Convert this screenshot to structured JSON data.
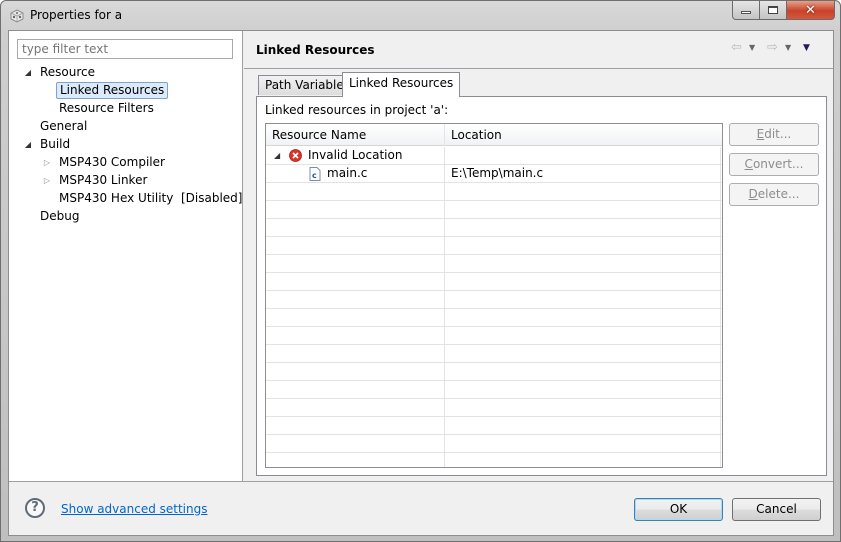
{
  "window": {
    "title": "Properties for a",
    "icon": "gear-cube-icon",
    "controls": [
      "minimize",
      "maximize",
      "close"
    ]
  },
  "sidebar": {
    "filter_placeholder": "type filter text",
    "filter_value": "",
    "tree": [
      {
        "label": "Resource",
        "level": 0,
        "expander": "expanded"
      },
      {
        "label": "Linked Resources",
        "level": 1,
        "expander": "none",
        "selected": true
      },
      {
        "label": "Resource Filters",
        "level": 1,
        "expander": "none"
      },
      {
        "label": "General",
        "level": 0,
        "expander": "none"
      },
      {
        "label": "Build",
        "level": 0,
        "expander": "expanded"
      },
      {
        "label": "MSP430 Compiler",
        "level": 1,
        "expander": "collapsed"
      },
      {
        "label": "MSP430 Linker",
        "level": 1,
        "expander": "collapsed"
      },
      {
        "label": "MSP430 Hex Utility  [Disabled]",
        "level": 1,
        "expander": "none"
      },
      {
        "label": "Debug",
        "level": 0,
        "expander": "none"
      }
    ]
  },
  "main": {
    "title": "Linked Resources",
    "nav": {
      "back": "back-arrow-icon",
      "forward": "forward-arrow-icon",
      "menu": "view-menu-icon"
    },
    "tabs": [
      {
        "label": "Path Variables",
        "active": false
      },
      {
        "label": "Linked Resources",
        "active": true
      }
    ],
    "caption": "Linked resources in project 'a':",
    "table": {
      "columns": [
        "Resource Name",
        "Location"
      ],
      "rows": [
        {
          "name": "Invalid Location",
          "location": "",
          "icon": "error-icon",
          "expander": "expanded",
          "indent": 0
        },
        {
          "name": "main.c",
          "location": "E:\\Temp\\main.c",
          "icon": "c-file-icon",
          "expander": "none",
          "indent": 1
        }
      ],
      "empty_rows": 16
    },
    "buttons": [
      {
        "label": "Edit...",
        "mnemonic": "E",
        "enabled": false
      },
      {
        "label": "Convert...",
        "mnemonic": "C",
        "enabled": false
      },
      {
        "label": "Delete...",
        "mnemonic": "D",
        "enabled": false
      }
    ]
  },
  "footer": {
    "help_icon": "help-icon",
    "advanced_link": "Show advanced settings",
    "ok_label": "OK",
    "cancel_label": "Cancel"
  }
}
